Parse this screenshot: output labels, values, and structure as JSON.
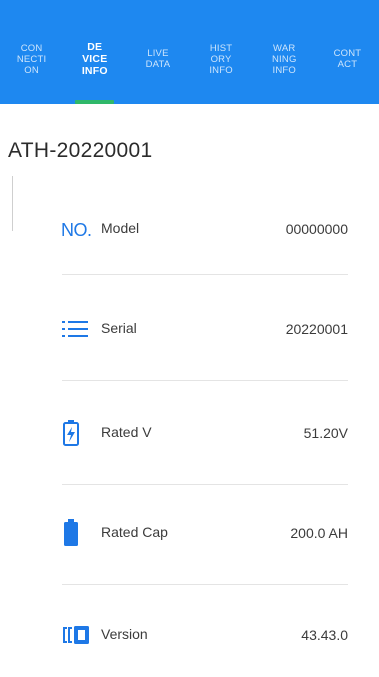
{
  "colors": {
    "header_bg": "#1e88f0",
    "accent_blue": "#1e78e6",
    "active_underline": "#2fb86a"
  },
  "tabs": [
    {
      "label": "CON\nNECTI\nON",
      "active": false
    },
    {
      "label": "DE\nVICE\nINFO",
      "active": true
    },
    {
      "label": "LIVE\nDATA",
      "active": false
    },
    {
      "label": "HIST\nORY\nINFO",
      "active": false
    },
    {
      "label": "WAR\nNING\nINFO",
      "active": false
    },
    {
      "label": "CONT\nACT",
      "active": false
    }
  ],
  "device": {
    "title": "ATH-20220001"
  },
  "rows": [
    {
      "icon": "no-icon",
      "icon_text": "NO.",
      "label": "Model",
      "value": "00000000"
    },
    {
      "icon": "list-icon",
      "label": "Serial",
      "value": "20220001"
    },
    {
      "icon": "battery-charging-icon",
      "label": "Rated V",
      "value": "51.20V"
    },
    {
      "icon": "battery-full-icon",
      "label": "Rated Cap",
      "value": "200.0 AH"
    },
    {
      "icon": "version-icon",
      "label": "Version",
      "value": "43.43.0"
    }
  ]
}
